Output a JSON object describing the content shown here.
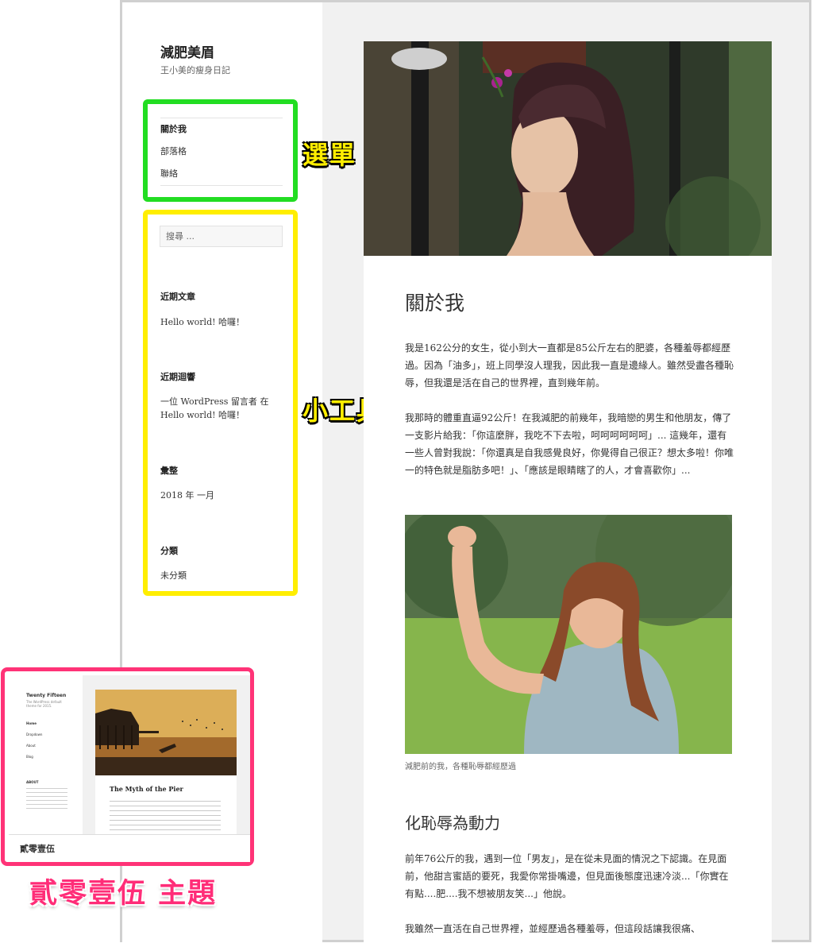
{
  "site": {
    "title": "減肥美眉",
    "description": "王小美的瘦身日記"
  },
  "menu": {
    "items": [
      {
        "label": "關於我"
      },
      {
        "label": "部落格"
      },
      {
        "label": "聯絡"
      }
    ]
  },
  "widgets": {
    "search_placeholder": "搜尋 ...",
    "recent_posts": {
      "title": "近期文章",
      "items": [
        "Hello world! 哈囉！"
      ]
    },
    "recent_comments": {
      "title": "近期迴響",
      "author": "一位 WordPress 留言者",
      "connector": "在",
      "post": "Hello world! 哈囉！"
    },
    "archives": {
      "title": "彙整",
      "items": [
        "2018 年 一月"
      ]
    },
    "categories": {
      "title": "分類",
      "items": [
        "未分類"
      ]
    }
  },
  "annotations": {
    "menu_label": "選單",
    "widgets_label": "小工具",
    "theme_label": "貳零壹伍 主題"
  },
  "article": {
    "title": "關於我",
    "paragraphs": [
      "我是162公分的女生，從小到大一直都是85公斤左右的肥婆，各種羞辱都經歷過。因為「油多」，班上同學沒人理我，因此我一直是邊緣人。雖然受盡各種恥辱，但我還是活在自己的世界裡，直到幾年前。",
      "我那時的體重直逼92公斤！在我減肥的前幾年，我暗戀的男生和他朋友，傳了一支影片給我：「你這麼胖，我吃不下去啦，呵呵呵呵呵呵」... 這幾年，還有一些人曾對我說：「你還真是自我感覺良好，你覺得自己很正？想太多啦！你唯一的特色就是脂肪多吧！」、「應該是眼睛瞎了的人，才會喜歡你」..."
    ],
    "image_caption": "減肥前的我，各種恥辱都經歷過",
    "heading2": "化恥辱為動力",
    "paragraphs2": [
      "前年76公斤的我，遇到一位「男友」，是在從未見面的情況之下認識。在見面前，他甜言蜜語的要死，我愛你常掛嘴邊，但見面後態度迅速冷淡...「你實在有點....肥....我不想被朋友笑...」他說。",
      "我雖然一直活在自己世界裡，並經歷過各種羞辱，但這段話讓我很痛、"
    ]
  },
  "theme_preview": {
    "site_title": "Twenty Fifteen",
    "site_desc": "The WordPress default theme for 2015.",
    "menu": [
      "Home",
      "Dropdown",
      "About",
      "Blog"
    ],
    "widget_title": "ABOUT",
    "post_title": "The Myth of the Pier",
    "theme_name": "貳零壹伍"
  },
  "colors": {
    "menu_highlight": "#22dd22",
    "widget_highlight": "#ffee00",
    "theme_highlight": "#ff3377"
  }
}
